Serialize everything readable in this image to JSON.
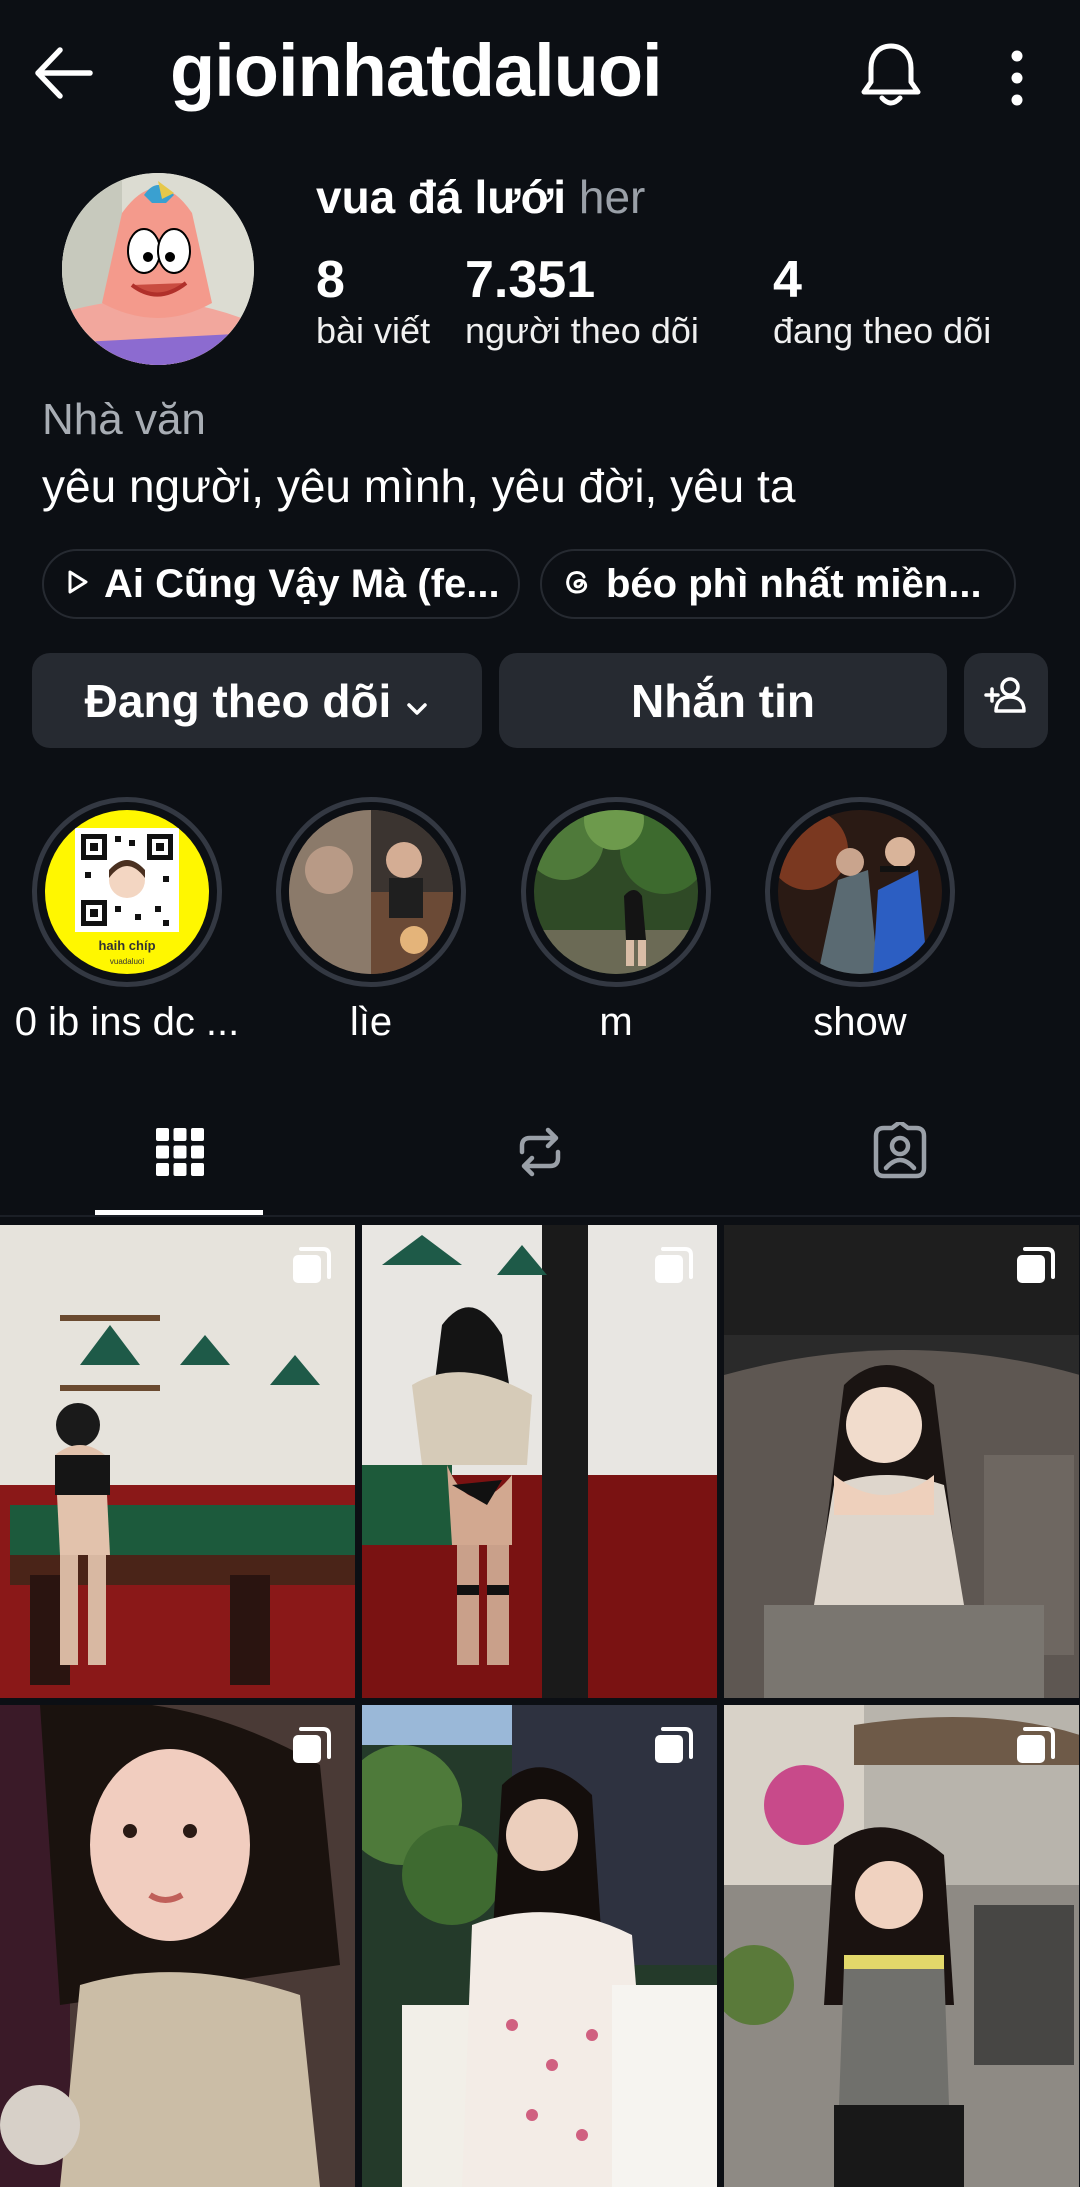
{
  "header": {
    "username": "gioinhatdaluoi",
    "icons": [
      "back-arrow-icon",
      "bell-icon",
      "more-vertical-icon"
    ]
  },
  "profile": {
    "display_name": "vua đá lưới",
    "pronouns": "her",
    "stats": [
      {
        "value": "8",
        "label": "bài viết"
      },
      {
        "value": "7.351",
        "label": "người theo dõi"
      },
      {
        "value": "4",
        "label": "đang theo dõi"
      }
    ],
    "category": "Nhà văn",
    "bio": "yêu người, yêu mình, yêu đời, yêu ta"
  },
  "chips": [
    {
      "icon": "play-icon",
      "label": "Ai Cũng Vậy Mà (fe..."
    },
    {
      "icon": "threads-icon",
      "label": "béo phì nhất miền..."
    }
  ],
  "actions": {
    "following_label": "Đang theo dõi",
    "message_label": "Nhắn tin"
  },
  "highlights": [
    {
      "label": "0 ib ins dc ...",
      "caption_top": "haih chíp",
      "caption_bottom": "vuadaluoi"
    },
    {
      "label": "lìe"
    },
    {
      "label": "m"
    },
    {
      "label": "show"
    }
  ],
  "tabs": [
    "grid-icon",
    "reels-repost-icon",
    "tagged-icon"
  ],
  "colors": {
    "background": "#0c0f14",
    "button": "#262a31",
    "muted_text": "#a8adb4"
  }
}
